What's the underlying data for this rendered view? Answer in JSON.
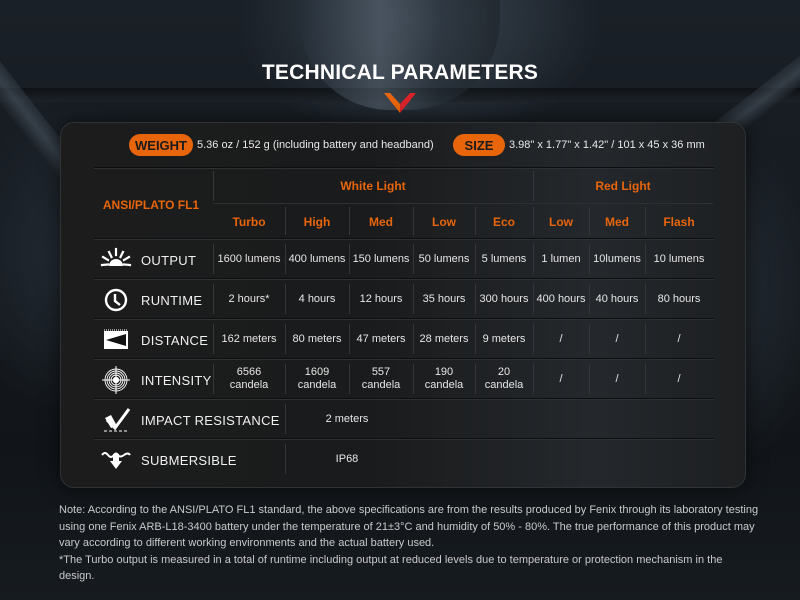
{
  "title": "TECHNICAL PARAMETERS",
  "colors": {
    "accent": "#e8650c",
    "chevron_left": "#e8650c",
    "chevron_right": "#d9232a",
    "panel_bg": "#1c1c1d"
  },
  "specs": {
    "weight": {
      "label": "WEIGHT",
      "value": "5.36 oz / 152 g (including battery and headband)"
    },
    "size": {
      "label": "SIZE",
      "value": "3.98\" x 1.77\" x 1.42\" / 101 x 45 x 36 mm"
    }
  },
  "table": {
    "standard_label": "ANSI/PLATO FL1",
    "groups": [
      {
        "label": "White Light",
        "modes": [
          "Turbo",
          "High",
          "Med",
          "Low",
          "Eco"
        ]
      },
      {
        "label": "Red Light",
        "modes": [
          "Low",
          "Med",
          "Flash"
        ]
      }
    ],
    "rows": [
      {
        "icon": "sunrise-output-icon",
        "label": "OUTPUT",
        "values": [
          "1600 lumens",
          "400 lumens",
          "150 lumens",
          "50 lumens",
          "5 lumens",
          "1 lumen",
          "10lumens",
          "10 lumens"
        ]
      },
      {
        "icon": "clock-icon",
        "label": "RUNTIME",
        "values": [
          "2 hours*",
          "4 hours",
          "12 hours",
          "35 hours",
          "300 hours",
          "400 hours",
          "40 hours",
          "80 hours"
        ]
      },
      {
        "icon": "beam-distance-icon",
        "label": "DISTANCE",
        "values": [
          "162 meters",
          "80 meters",
          "47 meters",
          "28 meters",
          "9 meters",
          "/",
          "/",
          "/"
        ]
      },
      {
        "icon": "target-intensity-icon",
        "label": "INTENSITY",
        "values": [
          "6566\ncandela",
          "1609\ncandela",
          "557\ncandela",
          "190\ncandela",
          "20\ncandela",
          "/",
          "/",
          "/"
        ]
      },
      {
        "icon": "impact-resistance-icon",
        "label": "IMPACT RESISTANCE",
        "span_value": "2 meters"
      },
      {
        "icon": "submersible-icon",
        "label": "SUBMERSIBLE",
        "span_value": "IP68"
      }
    ]
  },
  "notes": [
    "Note: According to the ANSI/PLATO FL1 standard, the above specifications are from the results produced by Fenix through its laboratory testing using one Fenix ARB-L18-3400 battery under the temperature of 21±3°C and humidity of 50% - 80%. The true performance of this product may vary according to different working environments and the actual battery used.",
    "*The Turbo output is measured in a total of runtime including output at reduced levels due to temperature or protection mechanism in the design."
  ]
}
